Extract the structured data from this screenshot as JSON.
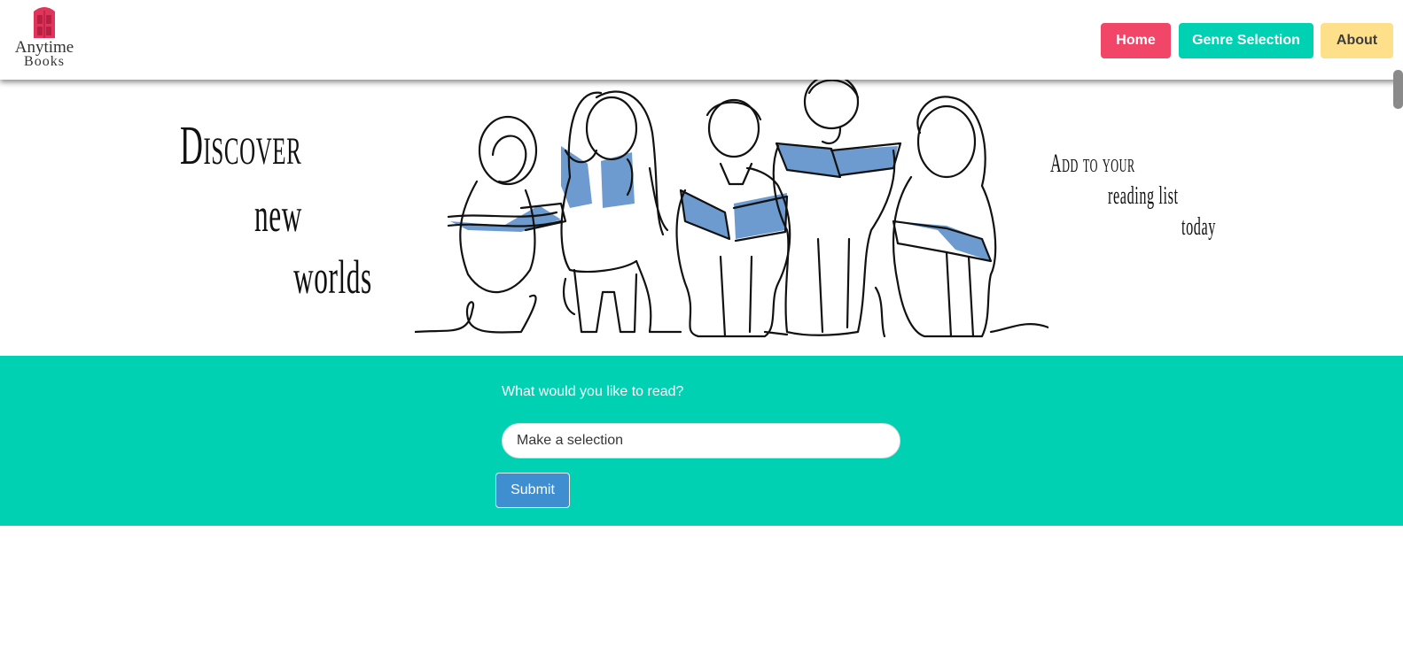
{
  "brand": {
    "line1": "Anytime",
    "line2": "Books",
    "icon": "pink-door-bookshelf-icon",
    "color": "#e0355a"
  },
  "nav": {
    "home": "Home",
    "genre": "Genre Selection",
    "about": "About"
  },
  "hero": {
    "left_words": [
      "Discover",
      "new",
      "worlds"
    ],
    "right_words": [
      "Add to your",
      "reading list",
      "today"
    ],
    "image": "line-drawing-of-people-reading-books"
  },
  "search": {
    "label": "What would you like to read?",
    "placeholder": "Make a selection",
    "submit": "Submit"
  },
  "colors": {
    "primary": "#00d1b2",
    "danger": "#f14668",
    "warning": "#ffe08a",
    "info": "#3e8ed0",
    "book_blue": "#6d9bd0"
  }
}
